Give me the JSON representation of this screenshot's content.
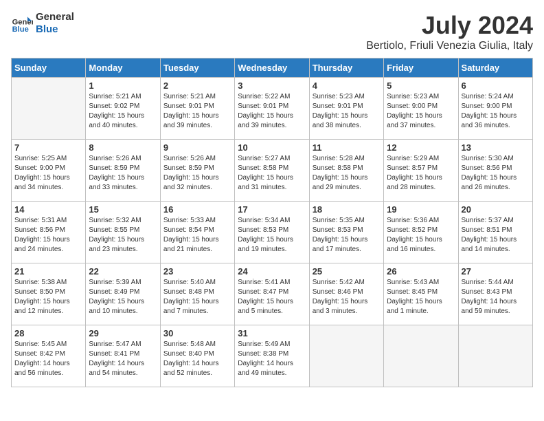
{
  "header": {
    "logo_line1": "General",
    "logo_line2": "Blue",
    "month": "July 2024",
    "location": "Bertiolo, Friuli Venezia Giulia, Italy"
  },
  "days_of_week": [
    "Sunday",
    "Monday",
    "Tuesday",
    "Wednesday",
    "Thursday",
    "Friday",
    "Saturday"
  ],
  "weeks": [
    [
      {
        "day": "",
        "info": ""
      },
      {
        "day": "1",
        "info": "Sunrise: 5:21 AM\nSunset: 9:02 PM\nDaylight: 15 hours\nand 40 minutes."
      },
      {
        "day": "2",
        "info": "Sunrise: 5:21 AM\nSunset: 9:01 PM\nDaylight: 15 hours\nand 39 minutes."
      },
      {
        "day": "3",
        "info": "Sunrise: 5:22 AM\nSunset: 9:01 PM\nDaylight: 15 hours\nand 39 minutes."
      },
      {
        "day": "4",
        "info": "Sunrise: 5:23 AM\nSunset: 9:01 PM\nDaylight: 15 hours\nand 38 minutes."
      },
      {
        "day": "5",
        "info": "Sunrise: 5:23 AM\nSunset: 9:00 PM\nDaylight: 15 hours\nand 37 minutes."
      },
      {
        "day": "6",
        "info": "Sunrise: 5:24 AM\nSunset: 9:00 PM\nDaylight: 15 hours\nand 36 minutes."
      }
    ],
    [
      {
        "day": "7",
        "info": "Sunrise: 5:25 AM\nSunset: 9:00 PM\nDaylight: 15 hours\nand 34 minutes."
      },
      {
        "day": "8",
        "info": "Sunrise: 5:26 AM\nSunset: 8:59 PM\nDaylight: 15 hours\nand 33 minutes."
      },
      {
        "day": "9",
        "info": "Sunrise: 5:26 AM\nSunset: 8:59 PM\nDaylight: 15 hours\nand 32 minutes."
      },
      {
        "day": "10",
        "info": "Sunrise: 5:27 AM\nSunset: 8:58 PM\nDaylight: 15 hours\nand 31 minutes."
      },
      {
        "day": "11",
        "info": "Sunrise: 5:28 AM\nSunset: 8:58 PM\nDaylight: 15 hours\nand 29 minutes."
      },
      {
        "day": "12",
        "info": "Sunrise: 5:29 AM\nSunset: 8:57 PM\nDaylight: 15 hours\nand 28 minutes."
      },
      {
        "day": "13",
        "info": "Sunrise: 5:30 AM\nSunset: 8:56 PM\nDaylight: 15 hours\nand 26 minutes."
      }
    ],
    [
      {
        "day": "14",
        "info": "Sunrise: 5:31 AM\nSunset: 8:56 PM\nDaylight: 15 hours\nand 24 minutes."
      },
      {
        "day": "15",
        "info": "Sunrise: 5:32 AM\nSunset: 8:55 PM\nDaylight: 15 hours\nand 23 minutes."
      },
      {
        "day": "16",
        "info": "Sunrise: 5:33 AM\nSunset: 8:54 PM\nDaylight: 15 hours\nand 21 minutes."
      },
      {
        "day": "17",
        "info": "Sunrise: 5:34 AM\nSunset: 8:53 PM\nDaylight: 15 hours\nand 19 minutes."
      },
      {
        "day": "18",
        "info": "Sunrise: 5:35 AM\nSunset: 8:53 PM\nDaylight: 15 hours\nand 17 minutes."
      },
      {
        "day": "19",
        "info": "Sunrise: 5:36 AM\nSunset: 8:52 PM\nDaylight: 15 hours\nand 16 minutes."
      },
      {
        "day": "20",
        "info": "Sunrise: 5:37 AM\nSunset: 8:51 PM\nDaylight: 15 hours\nand 14 minutes."
      }
    ],
    [
      {
        "day": "21",
        "info": "Sunrise: 5:38 AM\nSunset: 8:50 PM\nDaylight: 15 hours\nand 12 minutes."
      },
      {
        "day": "22",
        "info": "Sunrise: 5:39 AM\nSunset: 8:49 PM\nDaylight: 15 hours\nand 10 minutes."
      },
      {
        "day": "23",
        "info": "Sunrise: 5:40 AM\nSunset: 8:48 PM\nDaylight: 15 hours\nand 7 minutes."
      },
      {
        "day": "24",
        "info": "Sunrise: 5:41 AM\nSunset: 8:47 PM\nDaylight: 15 hours\nand 5 minutes."
      },
      {
        "day": "25",
        "info": "Sunrise: 5:42 AM\nSunset: 8:46 PM\nDaylight: 15 hours\nand 3 minutes."
      },
      {
        "day": "26",
        "info": "Sunrise: 5:43 AM\nSunset: 8:45 PM\nDaylight: 15 hours\nand 1 minute."
      },
      {
        "day": "27",
        "info": "Sunrise: 5:44 AM\nSunset: 8:43 PM\nDaylight: 14 hours\nand 59 minutes."
      }
    ],
    [
      {
        "day": "28",
        "info": "Sunrise: 5:45 AM\nSunset: 8:42 PM\nDaylight: 14 hours\nand 56 minutes."
      },
      {
        "day": "29",
        "info": "Sunrise: 5:47 AM\nSunset: 8:41 PM\nDaylight: 14 hours\nand 54 minutes."
      },
      {
        "day": "30",
        "info": "Sunrise: 5:48 AM\nSunset: 8:40 PM\nDaylight: 14 hours\nand 52 minutes."
      },
      {
        "day": "31",
        "info": "Sunrise: 5:49 AM\nSunset: 8:38 PM\nDaylight: 14 hours\nand 49 minutes."
      },
      {
        "day": "",
        "info": ""
      },
      {
        "day": "",
        "info": ""
      },
      {
        "day": "",
        "info": ""
      }
    ]
  ]
}
